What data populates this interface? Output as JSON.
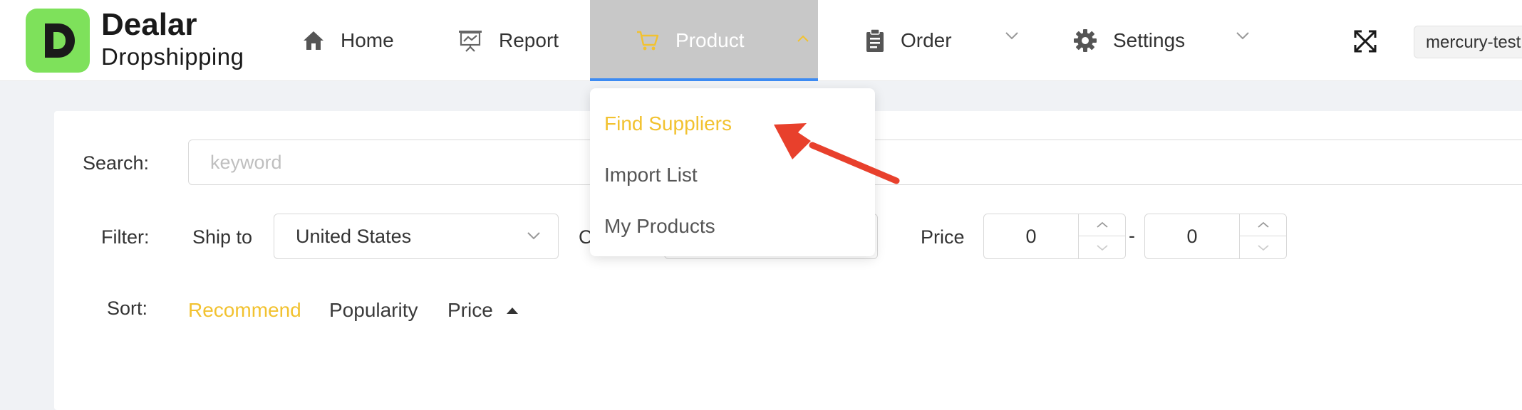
{
  "brand": {
    "name": "Dealar",
    "tagline": "Dropshipping",
    "logo_letter": "D",
    "color": "#7ee15b"
  },
  "nav": {
    "items": [
      {
        "label": "Home",
        "icon": "home-icon"
      },
      {
        "label": "Report",
        "icon": "presentation-chart-icon"
      },
      {
        "label": "Product",
        "icon": "shopping-cart-icon",
        "active": true
      },
      {
        "label": "Order",
        "icon": "clipboard-icon"
      },
      {
        "label": "Settings",
        "icon": "gear-icon"
      }
    ],
    "active_bg": "#c8c8c8",
    "active_underline": "#3d8bf2"
  },
  "account": {
    "label": "mercury-test"
  },
  "product_menu": {
    "items": [
      {
        "label": "Find Suppliers",
        "active": true
      },
      {
        "label": "Import List"
      },
      {
        "label": "My Products"
      }
    ],
    "active_color": "#f2c230"
  },
  "search": {
    "label": "Search:",
    "placeholder": "keyword"
  },
  "filter": {
    "label": "Filter:",
    "ship_to_label": "Ship to",
    "ship_to_value": "United States",
    "partial_label": "C",
    "price_label": "Price",
    "price_min": "0",
    "price_separator": "-",
    "price_max": "0"
  },
  "sort": {
    "label": "Sort:",
    "options": [
      "Recommend",
      "Popularity",
      "Price"
    ],
    "active": "Recommend",
    "active_color": "#f2c230"
  },
  "annotation": {
    "arrow_color": "#e8402c"
  }
}
